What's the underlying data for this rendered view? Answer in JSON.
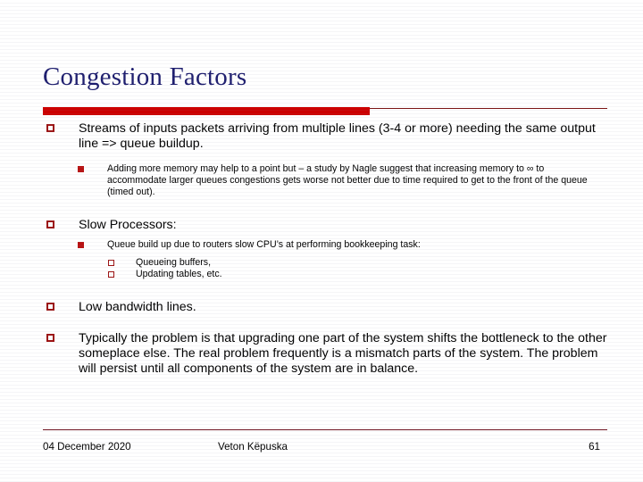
{
  "slide": {
    "title": "Congestion Factors",
    "accent_color": "#cc0000",
    "rule_color": "#7a1414",
    "title_color": "#1d1d6e",
    "marker_color": "#9c1313",
    "bullets": [
      {
        "level": 1,
        "marker": "hollow-square",
        "text": "Streams of inputs packets arriving from multiple lines (3-4 or more) needing the same output line => queue buildup."
      },
      {
        "level": 2,
        "marker": "filled-square",
        "text": "Adding more memory may help to a point but – a study by Nagle suggest that increasing memory to ∞ to accommodate larger queues congestions gets worse not better due to time required to get to the front of the queue (timed out)."
      },
      {
        "level": 1,
        "marker": "hollow-square",
        "text": "Slow Processors:"
      },
      {
        "level": 2,
        "marker": "filled-square",
        "text": "Queue build up due to routers slow CPU’s at performing bookkeeping task:"
      },
      {
        "level": 3,
        "marker": "hollow-square",
        "text": "Queueing buffers,"
      },
      {
        "level": 3,
        "marker": "hollow-square",
        "text": "Updating tables, etc."
      },
      {
        "level": 1,
        "marker": "hollow-square",
        "text": "Low bandwidth lines."
      },
      {
        "level": 1,
        "marker": "hollow-square",
        "text": "Typically the problem is that upgrading one part of the system shifts the bottleneck to the other someplace else. The real problem frequently is a mismatch parts of the system. The problem will persist until all components of the system are in balance."
      }
    ]
  },
  "footer": {
    "date": "04 December 2020",
    "author": "Veton Këpuska",
    "page_number": "61"
  }
}
